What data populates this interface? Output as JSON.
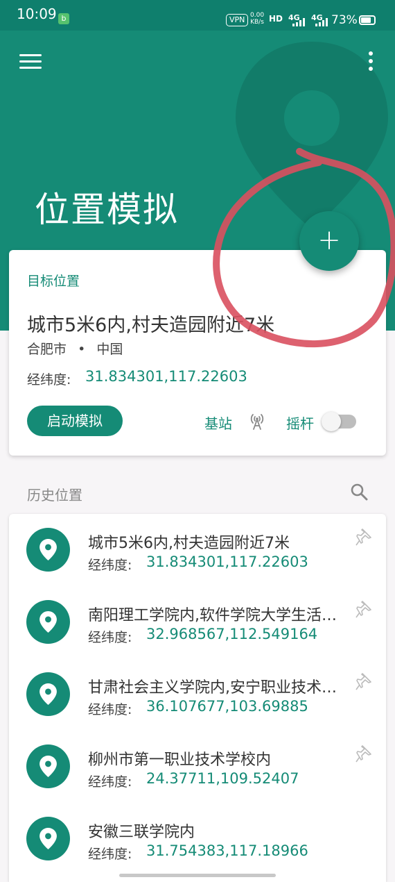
{
  "status_bar": {
    "time": "10:09",
    "app_badge": "b",
    "vpn": "VPN",
    "speed_value": "0.00",
    "speed_unit": "KB/s",
    "hd": "HD",
    "net1": "4G",
    "net2": "4G",
    "battery_percent": "73%"
  },
  "header": {
    "title": "位置模拟",
    "bg_color": "#158b76",
    "menu_icon": "hamburger-menu-icon",
    "more_icon": "more-vertical-icon"
  },
  "fab": {
    "label": "+",
    "icon": "add-icon"
  },
  "target_card": {
    "label": "目标位置",
    "name": "城市5米6内,村夫造园附近7米",
    "city": "合肥市",
    "separator": "•",
    "country": "中国",
    "coord_label": "经纬度:",
    "coord_value": "31.834301,117.22603",
    "start_button": "启动模拟",
    "base_station_label": "基站",
    "joystick_label": "摇杆",
    "joystick_enabled": false
  },
  "history": {
    "title": "历史位置",
    "coord_label": "经纬度:",
    "items": [
      {
        "name": "城市5米6内,村夫造园附近7米",
        "coord": "31.834301,117.22603"
      },
      {
        "name": "南阳理工学院内,软件学院大学生活动中心",
        "coord": "32.968567,112.549164"
      },
      {
        "name": "甘肃社会主义学院内,安宁职业技术学院",
        "coord": "36.107677,103.69885"
      },
      {
        "name": "柳州市第一职业技术学校内",
        "coord": "24.37711,109.52407"
      },
      {
        "name": "安徽三联学院内",
        "coord": "31.754383,117.18966"
      }
    ]
  },
  "annotation_color": "#d9505f"
}
